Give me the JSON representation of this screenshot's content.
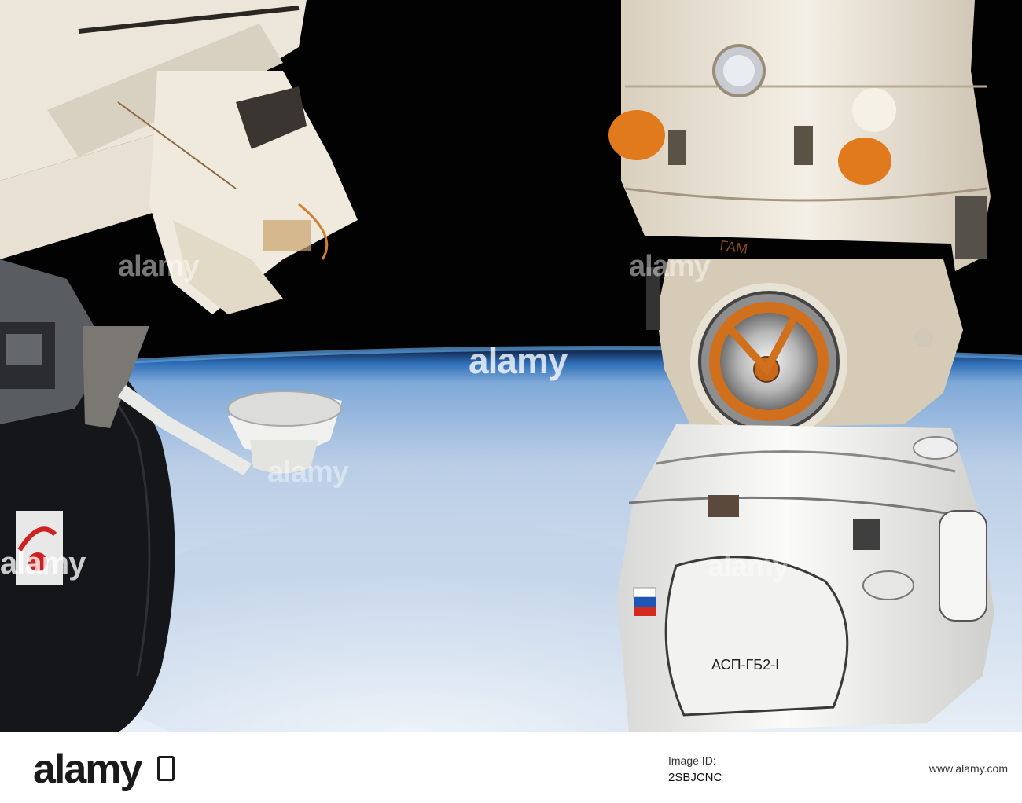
{
  "watermark": {
    "text": "alamy"
  },
  "module_labels": {
    "port_label": "АСП-ГБ2-I",
    "side_label": "ГАМ"
  },
  "footer": {
    "logo": "alamy",
    "image_id_label": "Image ID:",
    "image_id": "2SBJCNC",
    "url": "www.alamy.com"
  },
  "colors": {
    "space": "#020203",
    "earth": "#c9d7e8",
    "horizon": "#3e86c9",
    "insulation": "#e8dfcf",
    "orange_cover": "#e07a1c"
  }
}
